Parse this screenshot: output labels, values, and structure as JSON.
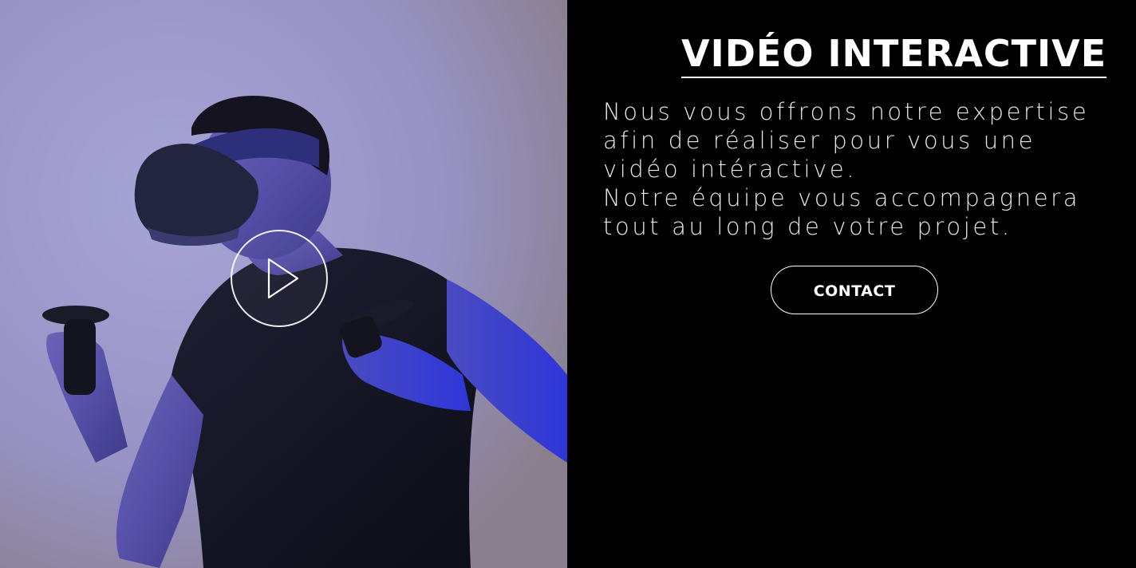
{
  "hero": {
    "title": "VIDÉO INTERACTIVE",
    "description_lines": [
      "Nous vous offrons notre expertise",
      "afin de réaliser pour vous une",
      "vidéo intéractive.",
      "Notre équipe vous accompagnera",
      "tout au long de votre projet."
    ],
    "contact_label": "CONTACT"
  },
  "media": {
    "image_subject": "man-wearing-vr-headset",
    "play_icon": "play-icon"
  },
  "colors": {
    "panel_background": "#000000",
    "text": "#ffffff",
    "photo_background": "#9d99c9"
  }
}
